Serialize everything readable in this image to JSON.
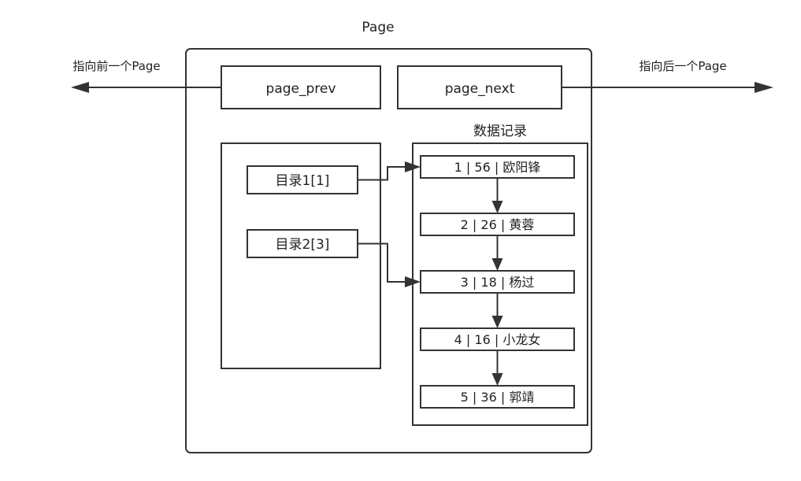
{
  "page": {
    "title": "Page"
  },
  "pointers": {
    "prev": {
      "field": "page_prev",
      "caption": "指向前一个Page"
    },
    "next": {
      "field": "page_next",
      "caption": "指向后一个Page"
    }
  },
  "records": {
    "title": "数据记录",
    "items": [
      {
        "label": "1 | 56 | 欧阳锋"
      },
      {
        "label": "2 | 26 | 黄蓉"
      },
      {
        "label": "3 | 18 | 杨过"
      },
      {
        "label": "4 | 16 | 小龙女"
      },
      {
        "label": "5 | 36 | 郭靖"
      }
    ]
  },
  "directory": {
    "items": [
      {
        "label": "目录1[1]",
        "points_to": 0
      },
      {
        "label": "目录2[3]",
        "points_to": 2
      }
    ]
  },
  "colors": {
    "stroke": "#333333",
    "background": "#ffffff",
    "text": "#222222"
  }
}
